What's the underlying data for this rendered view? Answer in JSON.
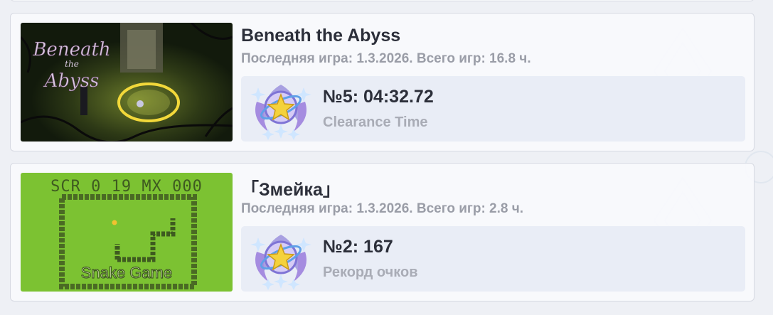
{
  "games": [
    {
      "title": "Beneath the Abyss",
      "meta": "Последняя игра: 1.3.2026. Всего игр: 16.8 ч.",
      "thumbnail_text": [
        "Beneath",
        "the",
        "Abyss"
      ],
      "achievement": {
        "rank": "№5: 04:32.72",
        "label": "Clearance Time"
      }
    },
    {
      "title": "「Змейка」",
      "meta": "Последняя игра: 1.3.2026. Всего игр: 2.8 ч.",
      "thumbnail_text": {
        "hud": "SCR 0 19 MX 000",
        "caption": "Snake Game"
      },
      "achievement": {
        "rank": "№2: 167",
        "label": "Рекорд очков"
      }
    }
  ],
  "colors": {
    "card_bg": "#f8f9fc",
    "title": "#2c2f3a",
    "meta": "#9a9da7",
    "achievement_bg": "#e9edf6",
    "snake_bg": "#7cc232",
    "snake_dark": "#3e5a20"
  }
}
